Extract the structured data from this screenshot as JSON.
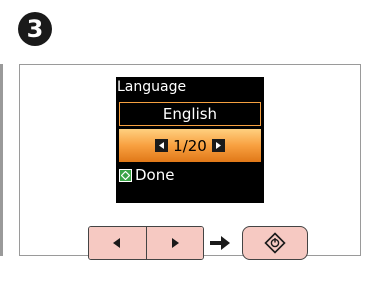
{
  "step": {
    "number": "3"
  },
  "lcd": {
    "title": "Language",
    "value": "English",
    "pager": "1/20",
    "done_label": "Done"
  },
  "buttons": {
    "left_icon": "left-triangle-icon",
    "right_icon": "right-triangle-icon",
    "then_icon": "right-arrow-icon",
    "start_icon": "start-diamond-icon"
  },
  "colors": {
    "button_fill": "#f6c9c2",
    "lcd_highlight": "#f8a040",
    "lcd_background": "#000000",
    "done_icon": "#3aa346",
    "badge": "#1a1a1a"
  }
}
